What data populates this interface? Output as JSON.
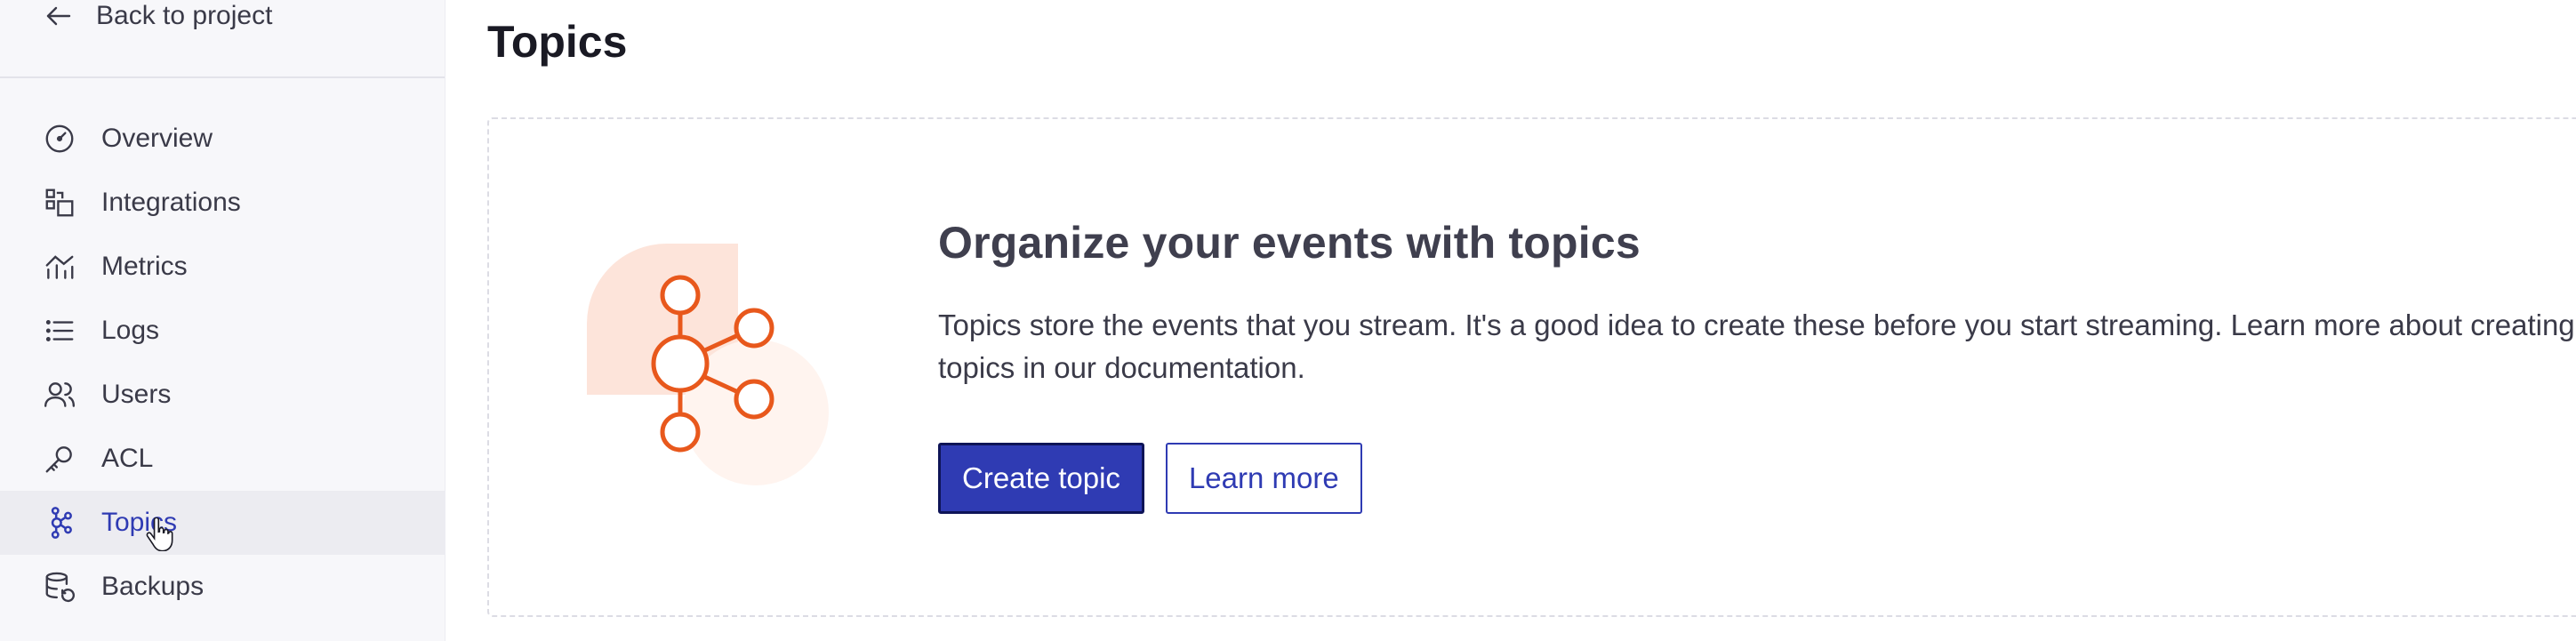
{
  "sidebar": {
    "back_label": "Back to project",
    "items": [
      {
        "label": "Overview",
        "icon": "gauge-icon"
      },
      {
        "label": "Integrations",
        "icon": "integrations-icon"
      },
      {
        "label": "Metrics",
        "icon": "metrics-icon"
      },
      {
        "label": "Logs",
        "icon": "list-icon"
      },
      {
        "label": "Users",
        "icon": "users-icon"
      },
      {
        "label": "ACL",
        "icon": "key-icon"
      },
      {
        "label": "Topics",
        "icon": "topics-icon",
        "active": true
      },
      {
        "label": "Backups",
        "icon": "database-icon"
      }
    ]
  },
  "main": {
    "title": "Topics",
    "empty_state": {
      "heading": "Organize your events with topics",
      "description": "Topics store the events that you stream. It's a good idea to create these before you start streaming. Learn more about creating topics in our documentation.",
      "primary_label": "Create topic",
      "secondary_label": "Learn more"
    }
  },
  "colors": {
    "accent": "#2f3bb3",
    "illustration_orange": "#e8581c",
    "illustration_bg": "#fde4da"
  }
}
